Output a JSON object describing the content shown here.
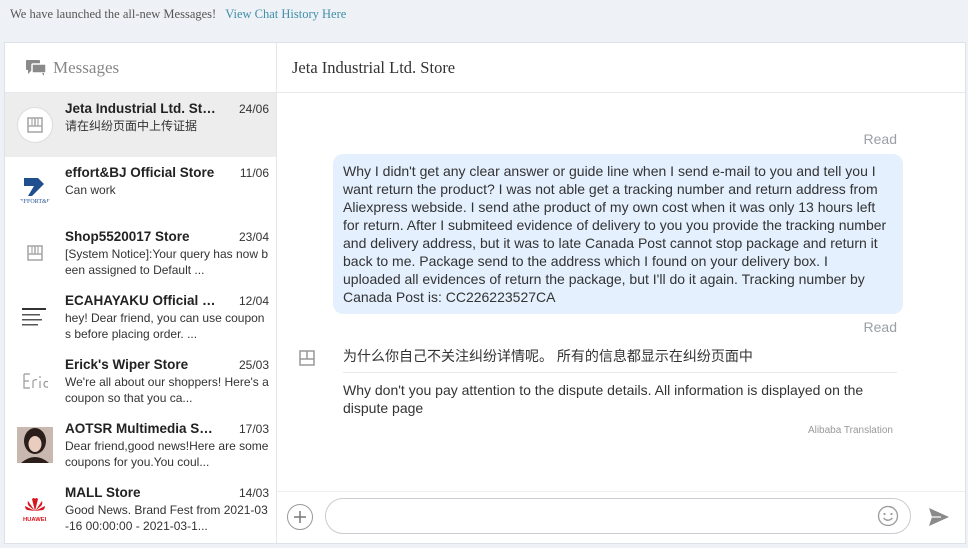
{
  "notice": {
    "text": "We have launched the all-new Messages!",
    "link": "View Chat History Here"
  },
  "sidebar": {
    "title": "Messages",
    "icon": "messages-icon",
    "conversations": [
      {
        "name": "Jeta Industrial Ltd. Store",
        "date": "24/06",
        "preview": "请在纠纷页面中上传证据",
        "avatar": "store-icon",
        "active": true
      },
      {
        "name": "effort&BJ Official Store",
        "date": "11/06",
        "preview": "Can work",
        "avatar": "effortbj-logo"
      },
      {
        "name": "Shop5520017 Store",
        "date": "23/04",
        "preview": "[System Notice]:Your query has now been assigned to Default ...",
        "avatar": "store-icon"
      },
      {
        "name": "ECAHAYAKU Official Store",
        "date": "12/04",
        "preview": "hey! Dear friend, you can use coupons before placing order. ...",
        "avatar": "ecahayaku-logo"
      },
      {
        "name": "Erick's Wiper Store",
        "date": "25/03",
        "preview": "We're all about our shoppers! Here's a coupon so that you ca...",
        "avatar": "erick-logo"
      },
      {
        "name": "AOTSR Multimedia Store",
        "date": "17/03",
        "preview": "Dear friend,good news!Here are some coupons for you.You coul...",
        "avatar": "aotsr-photo"
      },
      {
        "name": "MALL Store",
        "date": "14/03",
        "preview": "Good News. Brand Fest from 2021-03-16 00:00:00 - 2021-03-1...",
        "avatar": "huawei-logo"
      }
    ]
  },
  "chat": {
    "title": "Jeta Industrial Ltd. Store",
    "read_label_1": "Read",
    "outgoing_message": "Why I didn't get any clear answer or guide line when I send e-mail to you and tell you I want return the product? I was not able get a tracking number and return address from Aliexpress webside. I send athe product of my own cost when it was only 13 hours left for return. After I submiteed evidence of delivery to you you provide the tracking number and delivery address, but it was to late Canada Post cannot stop package and return it back to me. Package send to the address which I found on your delivery box. I uploaded all evidences of return the package, but I'll do it again. Tracking number by Canada Post is: CC226223527CA",
    "read_label_2": "Read",
    "incoming_original": "为什么你自己不关注纠纷详情呢。 所有的信息都显示在纠纷页面中",
    "incoming_translation": "Why don't you pay attention to the dispute details. All information is displayed on the dispute page",
    "translation_provider": "Alibaba Translation"
  },
  "composer": {
    "placeholder": ""
  },
  "colors": {
    "link": "#3f8fa8",
    "outgoing_bubble": "#e4f0fe",
    "active_conversation": "#ededed",
    "read_label": "#9aa0a6"
  }
}
